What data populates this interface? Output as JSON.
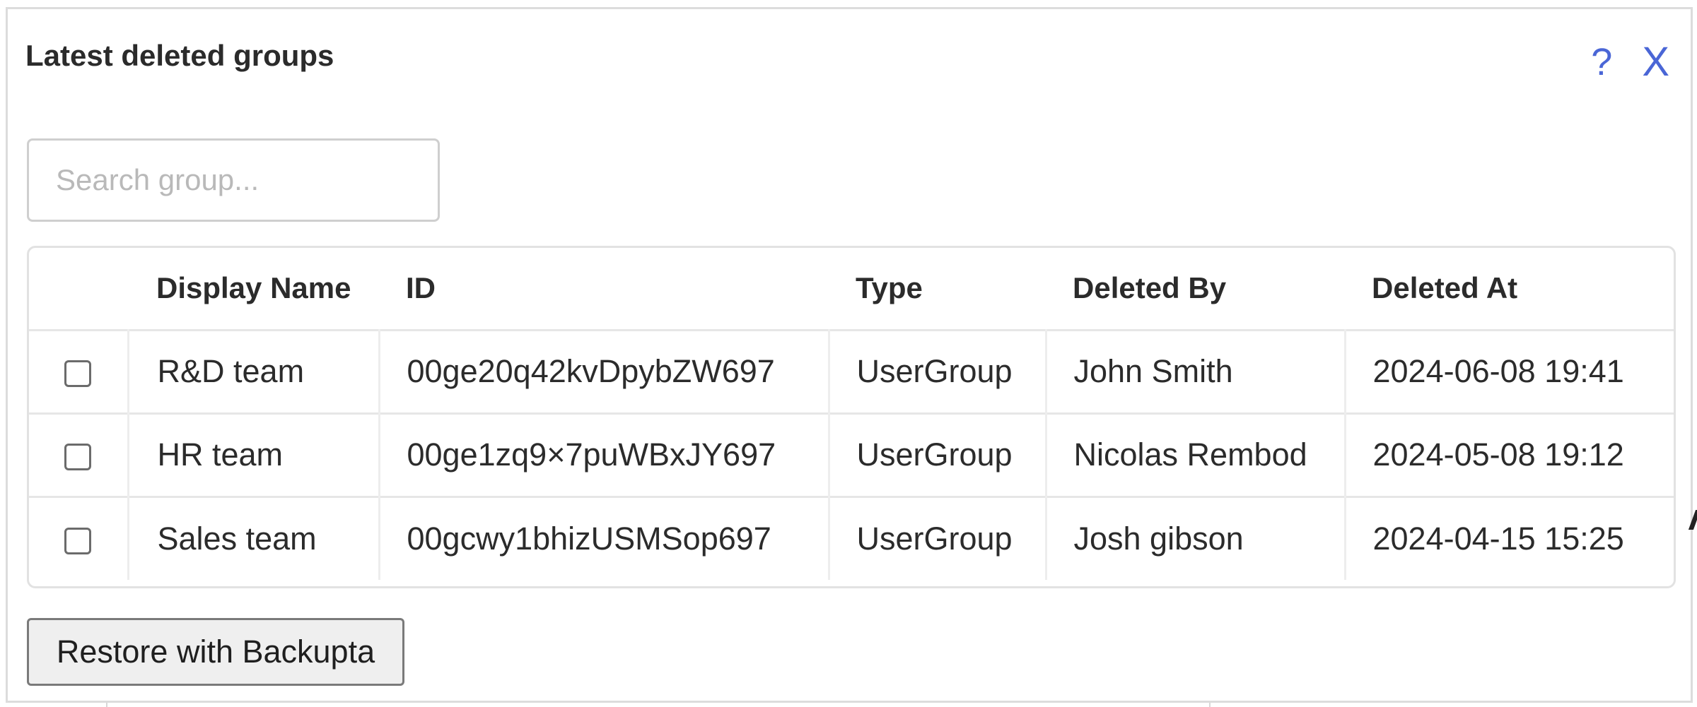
{
  "dialog": {
    "title": "Latest deleted groups",
    "help_label": "?",
    "close_label": "X"
  },
  "search": {
    "placeholder": "Search group..."
  },
  "table": {
    "columns": [
      "",
      "Display Name",
      "ID",
      "Type",
      "Deleted By",
      "Deleted At"
    ],
    "rows": [
      {
        "display_name": "R&D team",
        "id": "00ge20q42kvDpybZW697",
        "type": "UserGroup",
        "deleted_by": "John Smith",
        "deleted_at": "2024-06-08 19:41"
      },
      {
        "display_name": "HR team",
        "id": "00ge1zq9×7puWBxJY697",
        "type": "UserGroup",
        "deleted_by": "Nicolas Rembod",
        "deleted_at": "2024-05-08 19:12"
      },
      {
        "display_name": "Sales team",
        "id": "00gcwy1bhizUSMSop697",
        "type": "UserGroup",
        "deleted_by": "Josh gibson",
        "deleted_at": "2024-04-15 15:25"
      }
    ]
  },
  "actions": {
    "restore_label": "Restore with Backupta"
  },
  "colors": {
    "accent": "#4a66d6",
    "border": "#dcdcdc"
  }
}
